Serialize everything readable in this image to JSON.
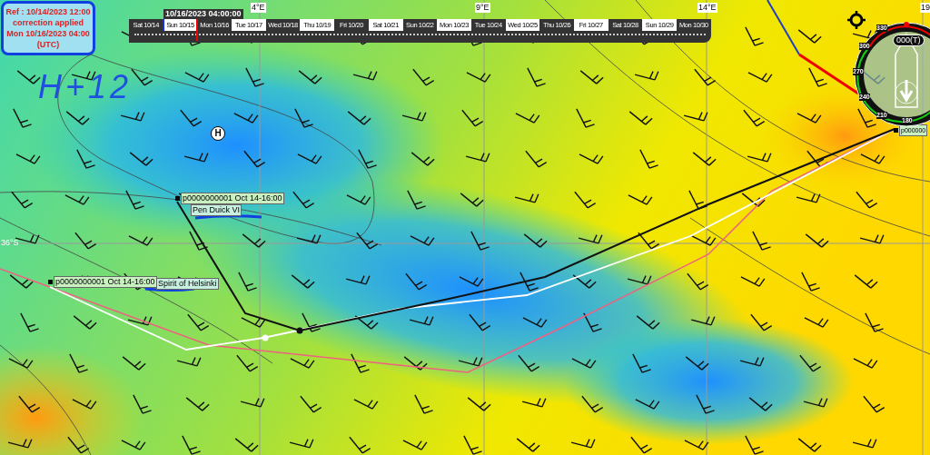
{
  "reference_box": {
    "lines": [
      "Ref : 10/14/2023 12:00",
      "correction applied",
      "Mon 10/16/2023 04:00",
      "(UTC)"
    ]
  },
  "annotation": "H+12",
  "timeline": {
    "current_time": "10/16/2023 04:00:00",
    "days": [
      {
        "label": "Sat 10/14"
      },
      {
        "label": "Sun 10/15"
      },
      {
        "label": "Mon 10/16"
      },
      {
        "label": "Tue 10/17"
      },
      {
        "label": "Wed 10/18"
      },
      {
        "label": "Thu 10/19"
      },
      {
        "label": "Fri 10/20"
      },
      {
        "label": "Sat 10/21"
      },
      {
        "label": "Sun 10/22"
      },
      {
        "label": "Mon 10/23"
      },
      {
        "label": "Tue 10/24"
      },
      {
        "label": "Wed 10/25"
      },
      {
        "label": "Thu 10/26"
      },
      {
        "label": "Fri 10/27"
      },
      {
        "label": "Sat 10/28"
      },
      {
        "label": "Sun 10/29"
      },
      {
        "label": "Mon 10/30"
      }
    ]
  },
  "grid_labels": {
    "longitudes": [
      "4°E",
      "9°E",
      "14°E",
      "19"
    ],
    "latitudes": [
      "36°S"
    ]
  },
  "pressure_centers": [
    {
      "label": "H"
    }
  ],
  "boats": [
    {
      "label": "p0000000001 Oct 14-16:00",
      "name": "Pen Duick VI"
    },
    {
      "label": "p0000000001 Oct 14-16:00",
      "name": "Spirit of Helsinki"
    },
    {
      "label": "p000000"
    }
  ],
  "compass": {
    "heading": "000(T)",
    "degrees": [
      "330",
      "300",
      "270",
      "240",
      "210",
      "180"
    ]
  }
}
